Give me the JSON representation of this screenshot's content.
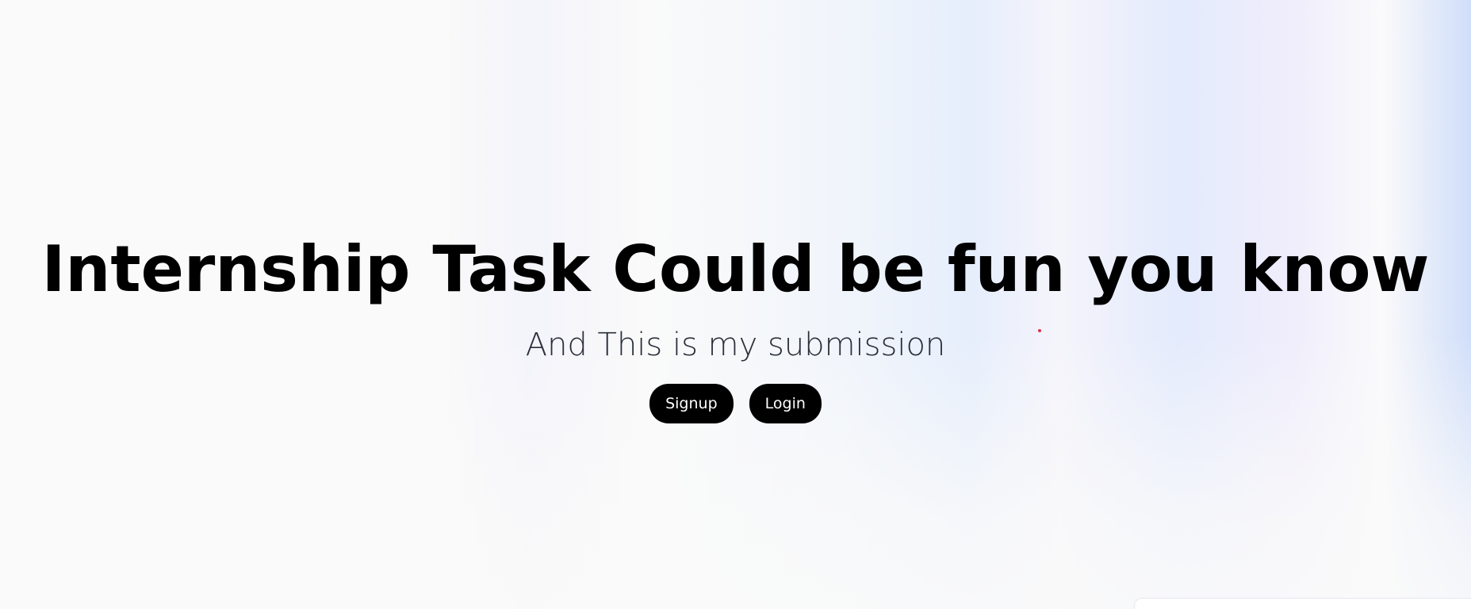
{
  "hero": {
    "title": "Internship Task Could be fun you know",
    "subtitle": "And This is my submission"
  },
  "actions": {
    "signup_label": "Signup",
    "login_label": "Login"
  },
  "colors": {
    "button_bg": "#000000",
    "button_text": "#ffffff",
    "title": "#000000",
    "subtitle": "#2a2f3a",
    "cursor_dot": "#e0324a"
  }
}
